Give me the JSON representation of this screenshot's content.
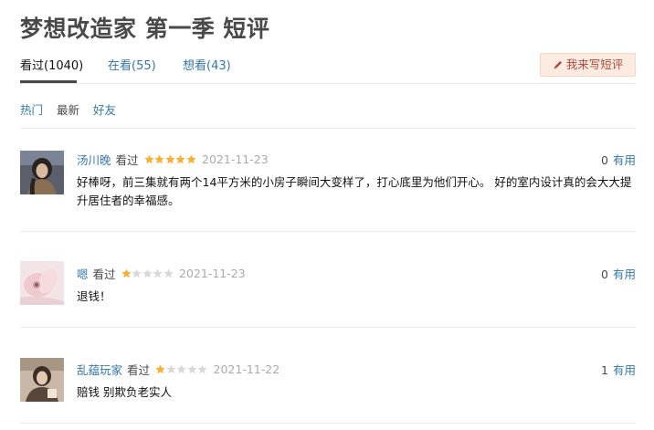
{
  "page": {
    "title": "梦想改造家 第一季 短评"
  },
  "tabs": [
    {
      "label": "看过(1040)"
    },
    {
      "label": "在看(55)"
    },
    {
      "label": "想看(43)"
    }
  ],
  "write_button": {
    "label": "我来写短评",
    "icon": "pencil-icon"
  },
  "filters": [
    {
      "label": "热门"
    },
    {
      "label": "最新"
    },
    {
      "label": "好友"
    }
  ],
  "colors": {
    "link": "#3377aa",
    "star_filled": "#ffac2d",
    "star_empty": "#d9d9d9",
    "button_bg": "#fcebe0",
    "button_text": "#b2493a"
  },
  "reviews": [
    {
      "user": "汤川晚",
      "status": "看过",
      "rating": 5,
      "date": "2021-11-23",
      "votes": "0",
      "useful_label": "有用",
      "content": "好棒呀，前三集就有两个14平方米的小房子瞬间大变样了，打心底里为他们开心。 好的室内设计真的会大大提升居住者的幸福感。"
    },
    {
      "user": "嗯",
      "status": "看过",
      "rating": 1,
      "date": "2021-11-23",
      "votes": "0",
      "useful_label": "有用",
      "content": "退钱！"
    },
    {
      "user": "乱蕴玩家",
      "status": "看过",
      "rating": 1,
      "date": "2021-11-22",
      "votes": "1",
      "useful_label": "有用",
      "content": "赔钱 别欺负老实人"
    }
  ]
}
